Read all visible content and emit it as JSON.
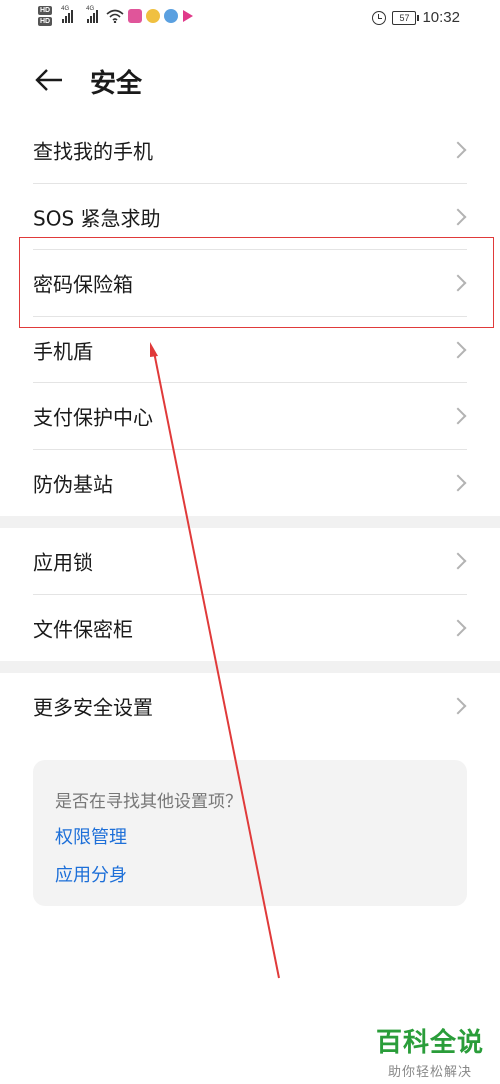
{
  "status_bar": {
    "hd_label": "HD",
    "net_label": "4G",
    "battery": "57",
    "time": "10:32"
  },
  "header": {
    "title": "安全"
  },
  "groups": [
    {
      "items": [
        {
          "label": "查找我的手机"
        },
        {
          "label": "SOS 紧急求助"
        },
        {
          "label": "密码保险箱"
        },
        {
          "label": "手机盾"
        },
        {
          "label": "支付保护中心"
        },
        {
          "label": "防伪基站"
        }
      ]
    },
    {
      "items": [
        {
          "label": "应用锁"
        },
        {
          "label": "文件保密柜"
        }
      ]
    },
    {
      "items": [
        {
          "label": "更多安全设置"
        }
      ]
    }
  ],
  "suggestions": {
    "question": "是否在寻找其他设置项？",
    "links": [
      "权限管理",
      "应用分身"
    ]
  },
  "watermark": {
    "title": "百科全说",
    "subtitle": "助你轻松解决"
  },
  "colors": {
    "link": "#1d6fd8",
    "annotation_red": "#e03a3a",
    "watermark_green": "#2a9d3a"
  },
  "icons": {
    "back": "arrow-left-icon",
    "chevron": "chevron-right-icon",
    "alarm": "alarm-clock-icon",
    "battery": "battery-icon",
    "wifi": "wifi-icon",
    "signal": "signal-icon"
  }
}
